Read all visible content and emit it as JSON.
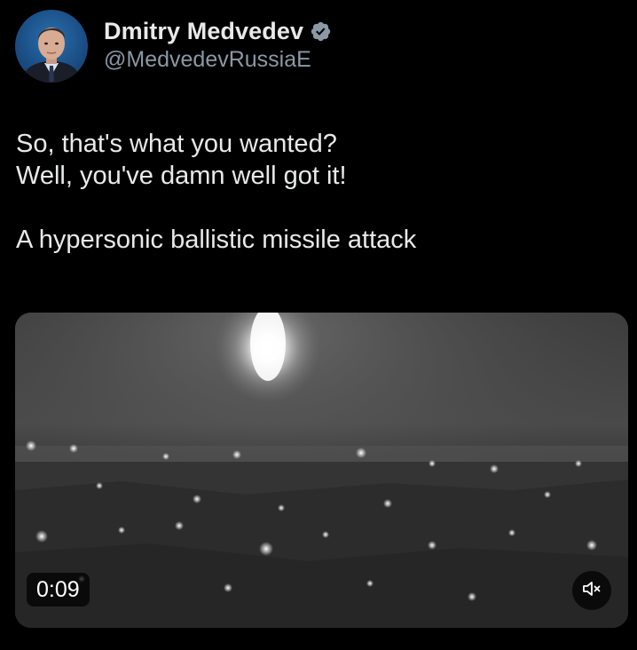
{
  "tweet": {
    "author": {
      "display_name": "Dmitry Medvedev",
      "handle": "@MedvedevRussiaE",
      "verified": true,
      "verified_color": "#8b98a5",
      "avatar_icon": "profile-photo"
    },
    "text_lines": [
      "So, that's what you wanted?",
      "Well, you've damn well got it!",
      "",
      "A hypersonic ballistic missile attack"
    ],
    "media": {
      "type": "video",
      "duration": "0:09",
      "muted": true,
      "mute_icon": "speaker-muted-icon"
    }
  },
  "colors": {
    "background": "#000000",
    "text_primary": "#e7e9ea",
    "text_secondary": "#8b98a5"
  }
}
